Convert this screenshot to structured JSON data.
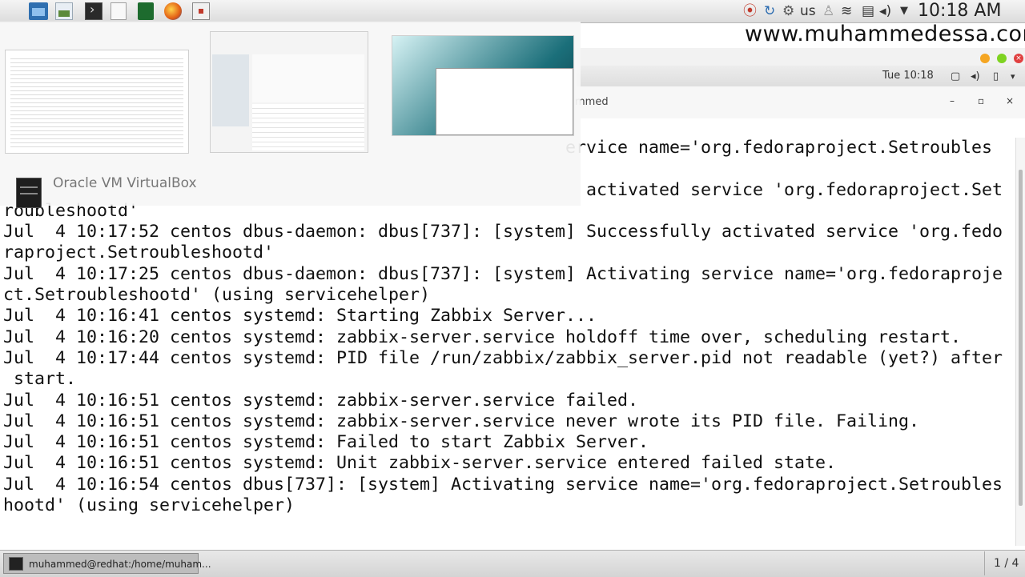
{
  "topbar": {
    "launchers": [
      "files-icon",
      "image-viewer-icon",
      "terminal-icon",
      "text-editor-icon",
      "package-icon",
      "firefox-icon",
      "virtualbox-icon"
    ],
    "keyboard_layout": "us",
    "clock": "10:18 AM"
  },
  "watermark": "www.muhammedessa.com",
  "switcher": {
    "label": "Oracle VM VirtualBox"
  },
  "terminal": {
    "date": "Tue 10:18",
    "title_fragment": "mmed",
    "lines": [
      "                                                      ervice name='org.fedoraproject.Setroubles",
      "",
      "                                                        activated service 'org.fedoraproject.Set",
      "roubleshootd'",
      "Jul  4 10:17:52 centos dbus-daemon: dbus[737]: [system] Successfully activated service 'org.fedo",
      "raproject.Setroubleshootd'",
      "Jul  4 10:17:25 centos dbus-daemon: dbus[737]: [system] Activating service name='org.fedoraproje",
      "ct.Setroubleshootd' (using servicehelper)",
      "Jul  4 10:16:41 centos systemd: Starting Zabbix Server...",
      "Jul  4 10:16:20 centos systemd: zabbix-server.service holdoff time over, scheduling restart.",
      "Jul  4 10:17:44 centos systemd: PID file /run/zabbix/zabbix_server.pid not readable (yet?) after",
      " start.",
      "Jul  4 10:16:51 centos systemd: zabbix-server.service failed.",
      "Jul  4 10:16:51 centos systemd: zabbix-server.service never wrote its PID file. Failing.",
      "Jul  4 10:16:51 centos systemd: Failed to start Zabbix Server.",
      "Jul  4 10:16:51 centos systemd: Unit zabbix-server.service entered failed state.",
      "Jul  4 10:16:54 centos dbus[737]: [system] Activating service name='org.fedoraproject.Setroubles",
      "hootd' (using servicehelper)"
    ]
  },
  "taskbar": {
    "task_label": "muhammed@redhat:/home/muham...",
    "pager": "1 / 4"
  }
}
